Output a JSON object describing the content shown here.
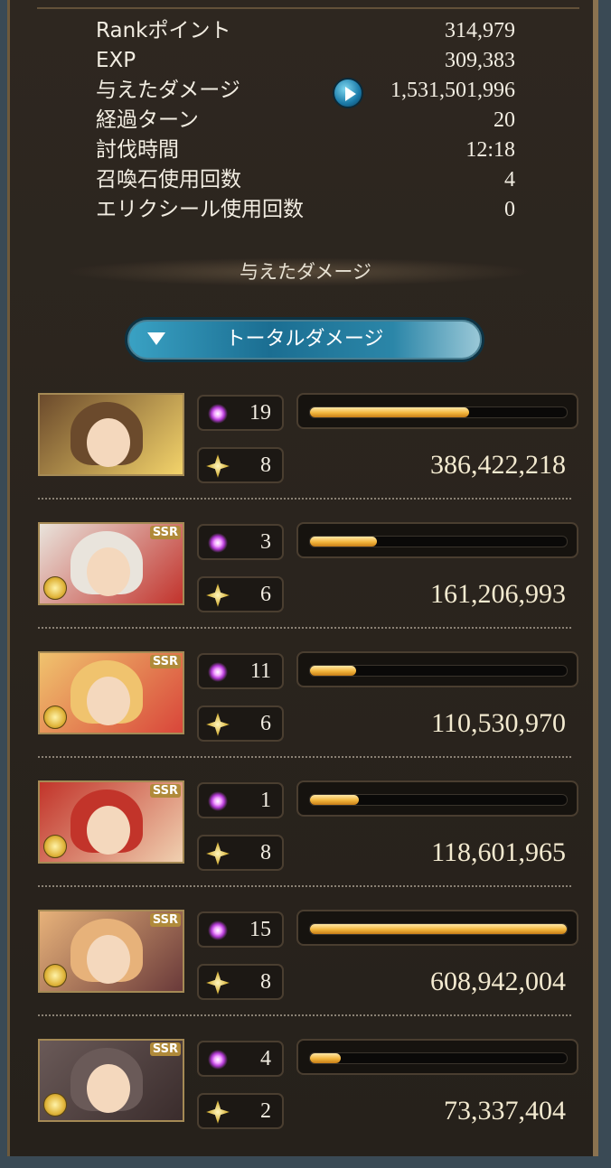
{
  "stats": [
    {
      "label": "Rankポイント",
      "value": "314,979"
    },
    {
      "label": "EXP",
      "value": "309,383"
    },
    {
      "label": "与えたダメージ",
      "value": "1,531,501,996"
    },
    {
      "label": "経過ターン",
      "value": "20"
    },
    {
      "label": "討伐時間",
      "value": "12:18"
    },
    {
      "label": "召喚石使用回数",
      "value": "4"
    },
    {
      "label": "エリクシール使用回数",
      "value": "0"
    }
  ],
  "section_title": "与えたダメージ",
  "dropdown_label": "トータルダメージ",
  "characters": [
    {
      "ougi": "19",
      "turns": "8",
      "damage": "386,422,218",
      "bar_fraction": 0.62,
      "ssr": "",
      "colors": [
        "#6b4a2c",
        "#f3d36a"
      ]
    },
    {
      "ougi": "3",
      "turns": "6",
      "damage": "161,206,993",
      "bar_fraction": 0.26,
      "ssr": "SSR",
      "colors": [
        "#e9e4dc",
        "#c2332c"
      ]
    },
    {
      "ougi": "11",
      "turns": "6",
      "damage": "110,530,970",
      "bar_fraction": 0.18,
      "ssr": "SSR",
      "colors": [
        "#f0c36e",
        "#d9463a"
      ]
    },
    {
      "ougi": "1",
      "turns": "8",
      "damage": "118,601,965",
      "bar_fraction": 0.19,
      "ssr": "SSR",
      "colors": [
        "#c2342a",
        "#f0d0b0"
      ]
    },
    {
      "ougi": "15",
      "turns": "8",
      "damage": "608,942,004",
      "bar_fraction": 1.0,
      "ssr": "SSR",
      "colors": [
        "#e7b27a",
        "#6a3a3a"
      ]
    },
    {
      "ougi": "4",
      "turns": "2",
      "damage": "73,337,404",
      "bar_fraction": 0.12,
      "ssr": "SSR",
      "colors": [
        "#6a5a58",
        "#3a2c2c"
      ]
    }
  ]
}
